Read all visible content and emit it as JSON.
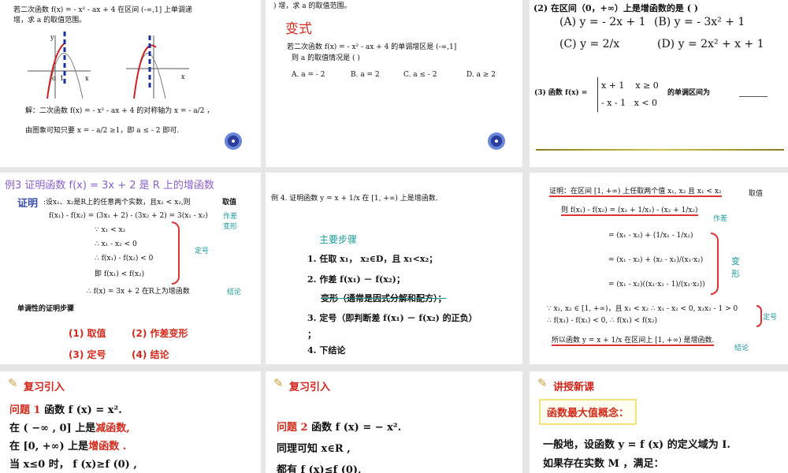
{
  "slides": [
    {
      "q1": "若二次函数 f(x) = - x² - ax + 4 在区间 (-∞,1] 上单调递",
      "q2": "增，求 a 的取值范围。",
      "g_o": "o",
      "g_1": "1",
      "g_x": "x",
      "g_y": "y",
      "sol1": "解：二次函数 f(x) = - x² - ax + 4 的对称轴为 x = - a/2 ，",
      "sol2": "由图象可知只要 x = - a/2 ≥1，即 a ≤ - 2 即可."
    },
    {
      "top": ")   增，求 a 的取值范围。",
      "title": "变式",
      "q1": "若二次函数 f(x) = - x² - ax + 4 的单调增区是   (-∞,1]",
      "q2": "则 a 的取值情况是    (      )",
      "opts": [
        "A. a = - 2",
        "B. a = 2",
        "C. a ≤ - 2",
        "D. a ≥ 2"
      ]
    },
    {
      "q2": "(2) 在区间（0，+∞）上是增函数的是    (   )",
      "a": "(A) y = - 2x + 1",
      "b": "(B) y = - 3x² + 1",
      "c": "(C) y = 2/x",
      "d": "(D) y = 2x² + x + 1",
      "q3": "(3) 函数 f(x) =",
      "p1": "x + 1    x ≥ 0",
      "p2": "- x - 1   x < 0",
      "q3b": "的单调区间为"
    },
    {
      "title": "例3  证明函数 f(x) = 3x + 2 是 R 上的增函数",
      "proof": "证明",
      "l1": ":设x₁、x₂是R上的任意两个实数，且x₁ < x₂,则",
      "l2": "f(x₁) - f(x₂) = (3x₁ + 2) - (3x₂ + 2) = 3(x₁ - x₂)",
      "l3": "∵  x₁ < x₂",
      "l4": "∴  x₁ - x₂ < 0",
      "l5": "∴ f(x₁) - f(x₂) < 0",
      "l6": "即   f(x₁) < f(x₂)",
      "l7": "∴ f(x) = 3x + 2 在R上为增函数",
      "m1": "取值",
      "m2": "作差变形",
      "m3": "定号",
      "m4": "结论",
      "steps_title": "单调性的证明步骤",
      "s1": "(1)  取值",
      "s2": "(2)  作差变形",
      "s3": "(3)  定号",
      "s4": "(4)  结论"
    },
    {
      "title": "例 4. 证明函数 y = x + 1/x   在          [1, +∞)   上是增函数.",
      "main": "主要步骤",
      "st1": "1.  任取 x₁， x₂∈D，且 x₁<x₂；",
      "st2": "2.  作差 f(x₁) － f(x₂)；",
      "st2b": "变形（通常是因式分解和配方）；",
      "st3": "3.  定号（即判断差 f(x₁) － f(x₂) 的正负）",
      "st3b": "；",
      "st4": "4.  下结论"
    },
    {
      "l1": "证明：在区间 [1, +∞) 上任取两个值 x₁, x₂ 且 x₁ < x₂",
      "l2": "则  f(x₁) - f(x₂) = (x₁ + 1/x₁) - (x₂ + 1/x₂)",
      "l3": "= (x₁ - x₂) + (1/x₁ - 1/x₂)",
      "l4": "= (x₁ - x₂) + (x₂ - x₁)/(x₁·x₂)",
      "l5": "= (x₁ - x₂)((x₁·x₂ - 1)/(x₁·x₂))",
      "l6": "∵ x₁, x₂ ∈ [1, +∞)，且 x₁ < x₂  ∴ x₁ - x₂ < 0, x₁x₂ - 1 > 0",
      "l7": "∴ f(x₁) - f(x₂) < 0, ∴ f(x₁) < f(x₂)",
      "l8": "所以函数 y = x + 1/x 在区间上  [1, +∞)  是增函数.",
      "m1": "取值",
      "m2": "作差",
      "m3": "变形",
      "m4": "定号",
      "m5": "结论"
    },
    {
      "hdr": "复习引入",
      "q": "问题 1",
      "q_rest": "  函数 f (x) = x².",
      "l1a": "在 ( −∞ , 0] 上是",
      "l1b": "减函数,",
      "l2a": "在 [0, +∞) 上是",
      "l2b": "增函数 .",
      "l3": "当 x≤0 时， f (x)≥f (0) ,"
    },
    {
      "hdr": "复习引入",
      "q": "问题 2",
      "q_rest": "  函数 f (x) = − x².",
      "l1": "同理可知 x∈R ,",
      "l2": "都有 f (x)≤f (0),"
    },
    {
      "hdr": "讲授新课",
      "box": "函数最大值概念：",
      "l1": "一般地，设函数 y = f (x) 的定义域为 I.",
      "l2": "如果存在实数 M ，满足："
    }
  ]
}
